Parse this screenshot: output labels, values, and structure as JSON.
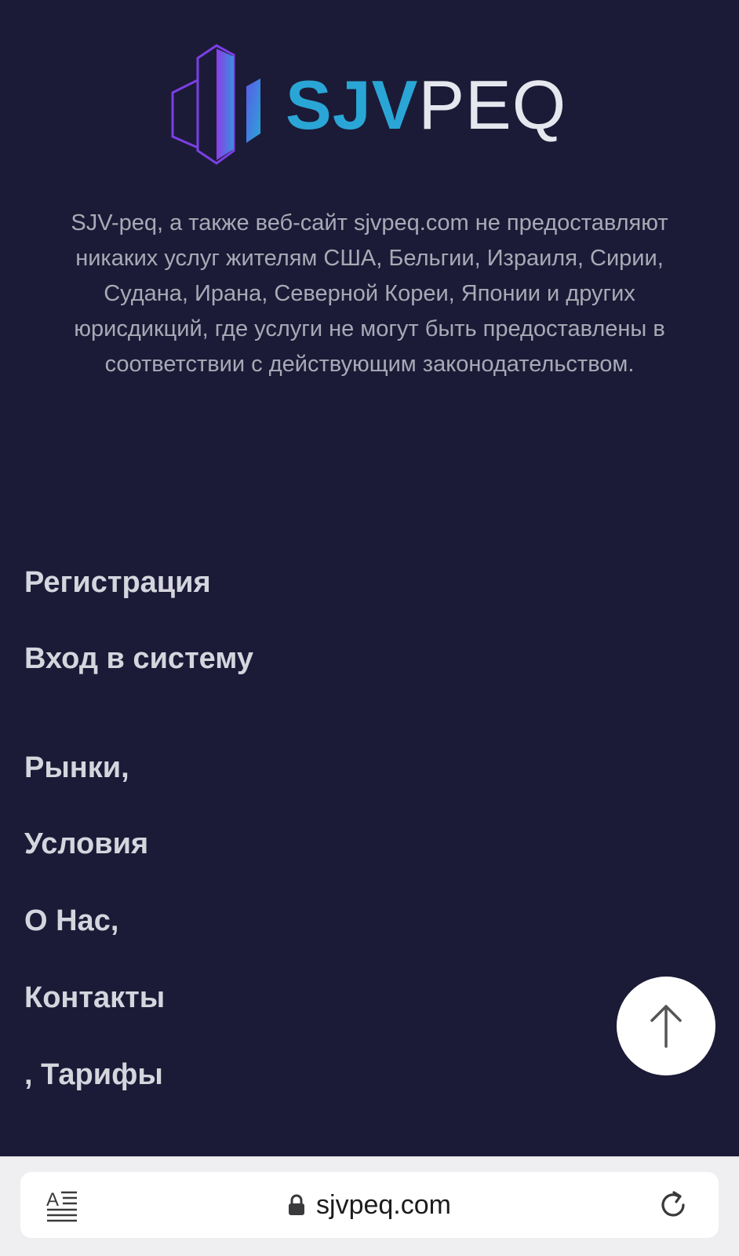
{
  "brand": {
    "name_accent": "SJV",
    "name_rest": "PEQ",
    "accent_color": "#2aa6d6",
    "mark_gradient": [
      "#8a3ee6",
      "#3aa0e0"
    ],
    "icon": "building-logo-icon"
  },
  "disclaimer": "SJV-peq, а также веб-сайт sjvpeq.com не предоставляют никаких услуг жителям США, Бельгии, Израиля, Сирии, Судана, Ирана, Северной Кореи, Японии и других юрисдикций, где услуги не могут быть предоставлены в соответствии с действующим законодательством.",
  "account_links": [
    {
      "label": "Регистрация"
    },
    {
      "label": "Вход в систему"
    }
  ],
  "footer_links": [
    {
      "label": "Рынки,"
    },
    {
      "label": "Условия"
    },
    {
      "label": "О Нас,"
    },
    {
      "label": "Контакты"
    },
    {
      "label": ", Тарифы"
    }
  ],
  "scroll_top": {
    "icon": "arrow-up-icon"
  },
  "browser": {
    "url": "sjvpeq.com",
    "reader_icon": "reader-mode-icon",
    "lock_icon": "lock-icon",
    "reload_icon": "reload-icon"
  },
  "colors": {
    "background": "#1b1b37",
    "text_muted": "#a9a9b6",
    "link": "#d5d5de"
  }
}
